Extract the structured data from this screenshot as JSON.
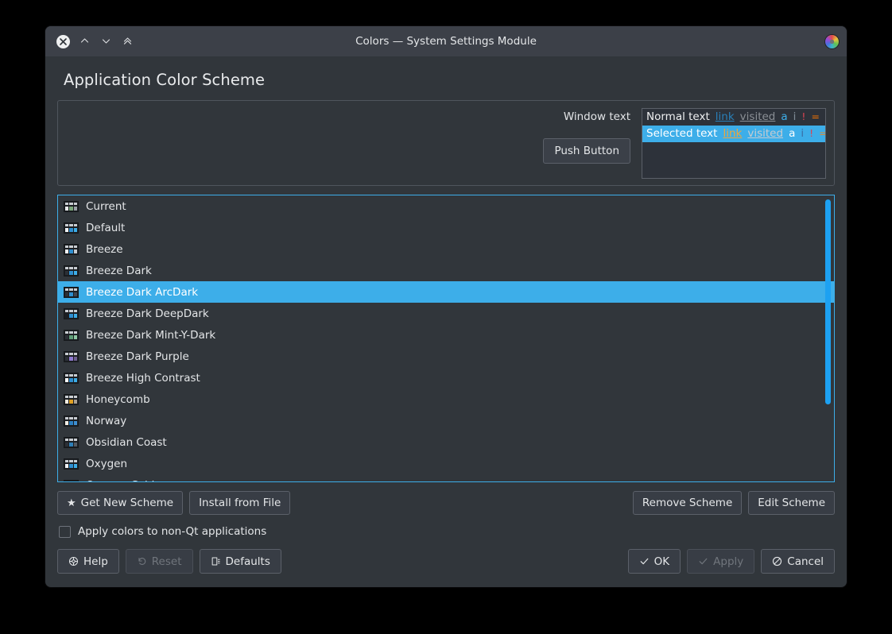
{
  "window": {
    "title": "Colors — System Settings Module",
    "titlebar_buttons": [
      {
        "name": "close",
        "icon": "close-icon"
      },
      {
        "name": "shade-up",
        "icon": "chevron-up-icon"
      },
      {
        "name": "shade-down",
        "icon": "chevron-down-icon"
      },
      {
        "name": "collapse-all",
        "icon": "double-chevron-up-icon"
      }
    ],
    "app_icon": "color-wheel-icon"
  },
  "page": {
    "title": "Application Color Scheme"
  },
  "preview": {
    "window_text_label": "Window text",
    "push_button_label": "Push Button",
    "rows": [
      {
        "text": "Normal text",
        "link": "link",
        "visited": "visited",
        "a": "a",
        "i": "i",
        "bang": "!",
        "eq": "=",
        "plus": "+",
        "selected": false
      },
      {
        "text": "Selected text",
        "link": "link",
        "visited": "visited",
        "a": "a",
        "i": "i",
        "bang": "!",
        "eq": "=",
        "plus": "+",
        "selected": true
      }
    ],
    "colors": {
      "normal_text": "#eff0f1",
      "link": "#2980b9",
      "link_selected": "#f0a73c",
      "visited": "#8a8f95",
      "selection_background": "#3daee9",
      "negative": "#da4453",
      "neutral": "#f67400",
      "positive": "#27ae60",
      "active": "#3daee9",
      "inactive": "#7f8b96"
    }
  },
  "scheme_list": {
    "selected_index": 4,
    "items": [
      {
        "label": "Current",
        "accent": "#7ba77b",
        "panel1": "#e8eaec",
        "panel2": "#7ba77b",
        "panel3": "#9aa0a6"
      },
      {
        "label": "Default",
        "accent": "#3daee9",
        "panel1": "#eff1f3",
        "panel2": "#2f8fd0",
        "panel3": "#3daee9"
      },
      {
        "label": "Breeze",
        "accent": "#3daee9",
        "panel1": "#eff1f3",
        "panel2": "#2f8fd0",
        "panel3": "#c4c9ce"
      },
      {
        "label": "Breeze Dark",
        "accent": "#3daee9",
        "panel1": "#2c3036",
        "panel2": "#2f8fd0",
        "panel3": "#3daee9"
      },
      {
        "label": "Breeze Dark ArcDark",
        "accent": "#3daee9",
        "panel1": "#2c3036",
        "panel2": "#2f8fd0",
        "panel3": "#3f4650"
      },
      {
        "label": "Breeze Dark DeepDark",
        "accent": "#3daee9",
        "panel1": "#1b1e22",
        "panel2": "#2f8fd0",
        "panel3": "#3daee9"
      },
      {
        "label": "Breeze Dark Mint-Y-Dark",
        "accent": "#6aa884",
        "panel1": "#2c3036",
        "panel2": "#5f9d77",
        "panel3": "#8fc7a4"
      },
      {
        "label": "Breeze Dark Purple",
        "accent": "#8f7ad0",
        "panel1": "#2c3036",
        "panel2": "#8f7ad0",
        "panel3": "#6f6090"
      },
      {
        "label": "Breeze High Contrast",
        "accent": "#3daee9",
        "panel1": "#ffffff",
        "panel2": "#2f8fd0",
        "panel3": "#3daee9"
      },
      {
        "label": "Honeycomb",
        "accent": "#e0a022",
        "panel1": "#f2ece0",
        "panel2": "#e0a022",
        "panel3": "#a8a094"
      },
      {
        "label": "Norway",
        "accent": "#3d8ed0",
        "panel1": "#f0ece4",
        "panel2": "#2b7ec0",
        "panel3": "#3d8ed0"
      },
      {
        "label": "Obsidian Coast",
        "accent": "#2f7fb8",
        "panel1": "#2c3036",
        "panel2": "#2f7fb8",
        "panel3": "#555b63"
      },
      {
        "label": "Oxygen",
        "accent": "#3daee9",
        "panel1": "#eff1f3",
        "panel2": "#2f8fd0",
        "panel3": "#3daee9"
      },
      {
        "label": "Oxygen Cold",
        "accent": "#3daee9",
        "panel1": "#eff1f3",
        "panel2": "#2f8fd0",
        "panel3": "#3daee9"
      }
    ]
  },
  "mid_buttons": {
    "get_new_scheme": "Get New Scheme",
    "install_from_file": "Install from File",
    "remove_scheme": "Remove Scheme",
    "edit_scheme": "Edit Scheme"
  },
  "checkbox": {
    "label": "Apply colors to non-Qt applications",
    "checked": false
  },
  "bottom_buttons": {
    "help": "Help",
    "reset": "Reset",
    "defaults": "Defaults",
    "ok": "OK",
    "apply": "Apply",
    "cancel": "Cancel",
    "reset_enabled": false,
    "apply_enabled": false
  }
}
